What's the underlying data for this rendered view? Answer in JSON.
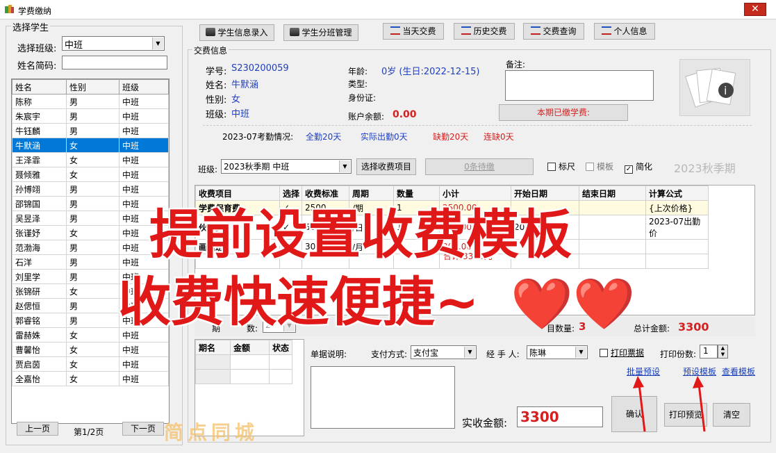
{
  "window": {
    "title": "学费缴纳",
    "close_glyph": "✕"
  },
  "left": {
    "group_label": "选择学生",
    "class_label": "选择班级:",
    "class_value": "中班",
    "name_abbr_label": "姓名简码:",
    "name_abbr_value": "",
    "columns": [
      "姓名",
      "性别",
      "班级"
    ],
    "students": [
      [
        "陈称",
        "男",
        "中班"
      ],
      [
        "朱宸宇",
        "男",
        "中班"
      ],
      [
        "牛钰麟",
        "男",
        "中班"
      ],
      [
        "牛默涵",
        "女",
        "中班"
      ],
      [
        "王泽霏",
        "女",
        "中班"
      ],
      [
        "聂倾雅",
        "女",
        "中班"
      ],
      [
        "孙博翊",
        "男",
        "中班"
      ],
      [
        "邵锦国",
        "男",
        "中班"
      ],
      [
        "吴昱泽",
        "男",
        "中班"
      ],
      [
        "张谨妤",
        "女",
        "中班"
      ],
      [
        "范渤海",
        "男",
        "中班"
      ],
      [
        "石洋",
        "男",
        "中班"
      ],
      [
        "刘里学",
        "男",
        "中班"
      ],
      [
        "张锦研",
        "女",
        "中班"
      ],
      [
        "赵偲恒",
        "男",
        "中班"
      ],
      [
        "郭睿铭",
        "男",
        "中班"
      ],
      [
        "雷赫姝",
        "女",
        "中班"
      ],
      [
        "曹馨怡",
        "女",
        "中班"
      ],
      [
        "贾启茵",
        "女",
        "中班"
      ],
      [
        "全嘉怡",
        "女",
        "中班"
      ]
    ],
    "selected_index": 3,
    "prev_label": "上一页",
    "page_info": "第1/2页",
    "next_label": "下一页"
  },
  "toolbar": [
    {
      "label": "学生信息录入",
      "icon": "student-entry-icon"
    },
    {
      "label": "学生分班管理",
      "icon": "class-manage-icon"
    },
    {
      "label": "当天交费",
      "icon": "today-fee-icon"
    },
    {
      "label": "历史交费",
      "icon": "history-fee-icon"
    },
    {
      "label": "交费查询",
      "icon": "fee-query-icon"
    },
    {
      "label": "个人信息",
      "icon": "personal-info-icon"
    }
  ],
  "fee_info": {
    "group_label": "交费信息",
    "student_no_label": "学号:",
    "student_no": "S230200059",
    "name_label": "姓名:",
    "name": "牛默涵",
    "gender_label": "性别:",
    "gender": "女",
    "class_label": "班级:",
    "class_name": "中班",
    "age_label": "年龄:",
    "age": "0岁 (生日:2022-12-15)",
    "type_label": "类型:",
    "id_label": "身份证:",
    "balance_label": "账户余额:",
    "balance": "0.00",
    "remark_label": "备注:",
    "paid_button": "本期已缴学费:",
    "attendance": {
      "month_label": "2023-07考勤情况:",
      "full": "全勤20天",
      "actual": "实际出勤0天",
      "absent": "缺勤20天",
      "consecutive": "连缺0天"
    },
    "term_label": "班级:",
    "term_value": "2023秋季期  中班",
    "select_items_button": "选择收费项目",
    "pending_button": "0条待缴",
    "options": [
      {
        "label": "标尺",
        "checked": false
      },
      {
        "label": "模板",
        "checked": false
      },
      {
        "label": "简化",
        "checked": true
      }
    ],
    "term_watermark": "2023秋季期"
  },
  "fee_table": {
    "columns": [
      "收费项目",
      "选择",
      "收费标准",
      "周期",
      "数量",
      "小计",
      "开始日期",
      "结束日期",
      "计算公式"
    ],
    "rows": [
      [
        "学费保育费",
        "✓",
        "2500",
        "/期",
        "1",
        "2500.00",
        "",
        "",
        "{上次价格}"
      ],
      [
        "伙食费",
        "✓",
        "500",
        "/日",
        "1",
        "500.00",
        "2023-07-05",
        "",
        "2023-07出勤价"
      ],
      [
        "画画班",
        "✓",
        "300",
        "/月",
        "1",
        "300.00",
        "",
        "",
        ""
      ]
    ],
    "total_text": "合计:3300元",
    "item_count_label": "目数量:",
    "item_count": "3",
    "total_amount_label": "总计金额:",
    "total_amount": "3300",
    "period_label": "期",
    "qty_label": "数:",
    "qty_value": "2"
  },
  "installments": {
    "columns": [
      "期名",
      "金额",
      "状态"
    ]
  },
  "payment": {
    "receipt_note_label": "单据说明:",
    "method_label": "支付方式:",
    "method_value": "支付宝",
    "handler_label": "经 手 人:",
    "handler_value": "陈琳",
    "print_receipt_label": "打印票据",
    "copies_label": "打印份数:",
    "copies_value": "1",
    "batch_preset_link": "批量预设",
    "preset_template_link": "预设模板",
    "view_template_link": "查看模板",
    "actual_amount_label": "实收金额:",
    "actual_amount": "3300",
    "confirm_button": "确认",
    "print_preview_button": "打印预览",
    "clear_button": "清空"
  },
  "overlay": {
    "line1": "提前设置收费模板",
    "line2": "收费快速便捷~",
    "hearts": "❤️❤️",
    "watermark": "简点同城"
  },
  "colors": {
    "selection": "#0078d7",
    "accent_red": "#d42020",
    "info_blue": "#1f3fbf"
  }
}
